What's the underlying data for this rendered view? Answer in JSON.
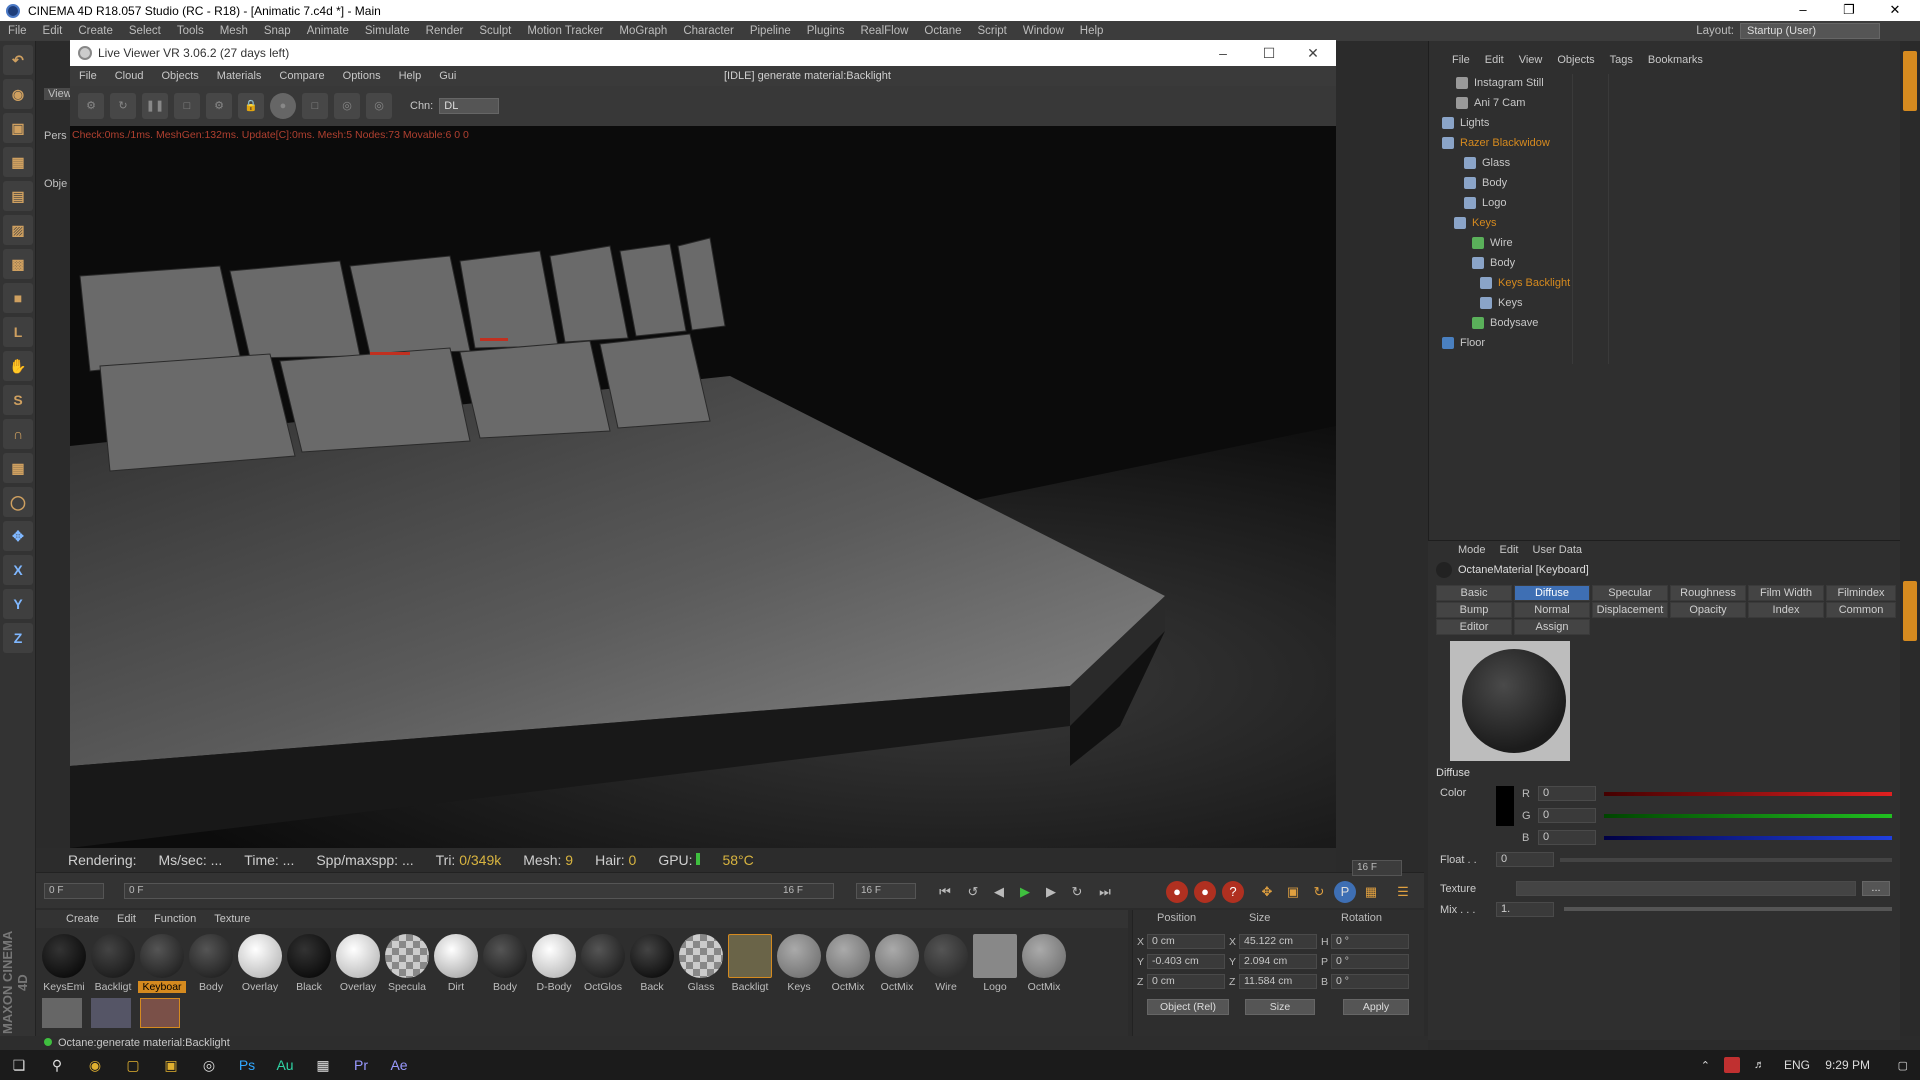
{
  "window": {
    "title": "CINEMA 4D R18.057 Studio (RC - R18) - [Animatic 7.c4d *] - Main"
  },
  "menu": [
    "File",
    "Edit",
    "Create",
    "Select",
    "Tools",
    "Mesh",
    "Snap",
    "Animate",
    "Simulate",
    "Render",
    "Sculpt",
    "Motion Tracker",
    "MoGraph",
    "Character",
    "Pipeline",
    "Plugins",
    "RealFlow",
    "Octane",
    "Script",
    "Window",
    "Help"
  ],
  "layout": {
    "label": "Layout:",
    "value": "Startup (User)"
  },
  "live_viewer": {
    "title": "Live Viewer VR 3.06.2 (27 days left)",
    "menu": [
      "File",
      "Cloud",
      "Objects",
      "Materials",
      "Compare",
      "Options",
      "Help",
      "Gui"
    ],
    "status": "[IDLE] generate material:Backlight",
    "chn_label": "Chn:",
    "chn_value": "DL",
    "render_info": "Check:0ms./1ms. MeshGen:132ms. Update[C]:0ms. Mesh:5 Nodes:73 Movable:6  0 0"
  },
  "viewport_stub": {
    "tab": "View",
    "pers": "Pers",
    "obj": "Obje"
  },
  "render_status": {
    "rendering": "Rendering:",
    "ms_sec": "Ms/sec: ...",
    "time": "Time: ...",
    "spp": "Spp/maxspp: ...",
    "tri_label": "Tri:",
    "tri_value": "0/349k",
    "mesh_label": "Mesh:",
    "mesh_value": "9",
    "hair_label": "Hair:",
    "hair_value": "0",
    "gpu_label": "GPU:",
    "temp": "58°C"
  },
  "timeline": {
    "start": "0 F",
    "range_start": "0 F",
    "range_end": "16 F",
    "end": "16 F",
    "frame": "16 F"
  },
  "material_menu": [
    "Create",
    "Edit",
    "Function",
    "Texture"
  ],
  "materials": [
    "KeysEmi",
    "Backligt",
    "Keyboar",
    "Body",
    "Overlay",
    "Black",
    "Overlay",
    "Specula",
    "Dirt",
    "Body",
    "D-Body",
    "OctGlos",
    "Back",
    "Glass",
    "Backligt",
    "Keys",
    "OctMix",
    "OctMix",
    "Wire",
    "Logo",
    "OctMix"
  ],
  "selected_material": "Keyboar",
  "coordinates": {
    "headers": [
      "Position",
      "Size",
      "Rotation"
    ],
    "rows": [
      {
        "axis": "X",
        "pos": "0 cm",
        "size_axis": "X",
        "size": "45.122 cm",
        "rot_axis": "H",
        "rot": "0 °"
      },
      {
        "axis": "Y",
        "pos": "-0.403 cm",
        "size_axis": "Y",
        "size": "2.094 cm",
        "rot_axis": "P",
        "rot": "0 °"
      },
      {
        "axis": "Z",
        "pos": "0 cm",
        "size_axis": "Z",
        "size": "11.584 cm",
        "rot_axis": "B",
        "rot": "0 °"
      }
    ],
    "mode": "Object (Rel)",
    "size_mode": "Size",
    "apply": "Apply"
  },
  "object_manager": {
    "menu": [
      "File",
      "Edit",
      "View",
      "Objects",
      "Tags",
      "Bookmarks"
    ],
    "objects": [
      {
        "name": "Instagram Still",
        "indent": 0,
        "orange": false
      },
      {
        "name": "Ani 7 Cam",
        "indent": 0,
        "orange": false
      },
      {
        "name": "Lights",
        "indent": 0,
        "orange": false
      },
      {
        "name": "Razer Blackwidow",
        "indent": 0,
        "orange": true
      },
      {
        "name": "Glass",
        "indent": 1,
        "orange": false
      },
      {
        "name": "Body",
        "indent": 1,
        "orange": false
      },
      {
        "name": "Logo",
        "indent": 1,
        "orange": false
      },
      {
        "name": "Keys",
        "indent": 1,
        "orange": true
      },
      {
        "name": "Wire",
        "indent": 2,
        "orange": false
      },
      {
        "name": "Body",
        "indent": 2,
        "orange": false
      },
      {
        "name": "Keys Backlight",
        "indent": 2,
        "orange": true
      },
      {
        "name": "Keys",
        "indent": 2,
        "orange": false
      },
      {
        "name": "Bodysave",
        "indent": 2,
        "orange": false
      },
      {
        "name": "Floor",
        "indent": 0,
        "orange": false
      }
    ]
  },
  "attributes": {
    "menu": [
      "Mode",
      "Edit",
      "User Data"
    ],
    "material_name": "OctaneMaterial [Keyboard]",
    "tabs_row1": [
      "Basic",
      "Diffuse",
      "Specular",
      "Roughness",
      "Film Width",
      "Filmindex"
    ],
    "tabs_row2": [
      "Bump",
      "Normal",
      "Displacement",
      "Opacity",
      "Index",
      "Common"
    ],
    "tabs_row3": [
      "Editor",
      "Assign"
    ],
    "active_tab": "Diffuse",
    "section": "Diffuse",
    "color_label": "Color",
    "r": "0",
    "g": "0",
    "b": "0",
    "float_label": "Float . .",
    "float_value": "0",
    "texture_label": "Texture",
    "mix_label": "Mix . . .",
    "mix_value": "1."
  },
  "status_bar": "Octane:generate material:Backlight",
  "taskbar": {
    "lang": "ENG",
    "time": "9:29 PM"
  },
  "colors": {
    "accent": "#d58a1f",
    "tab_active": "#3e6fb4",
    "render_warn": "#b04030"
  }
}
